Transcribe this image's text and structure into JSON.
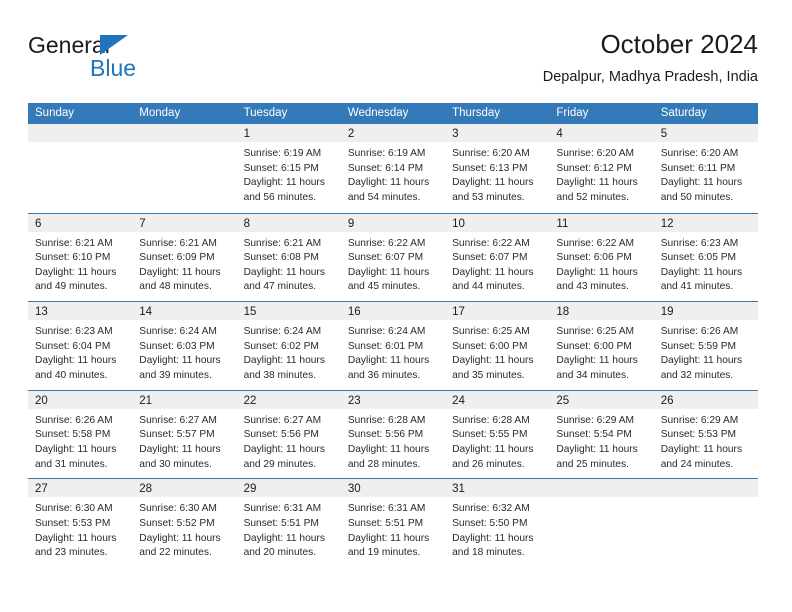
{
  "brand": {
    "name_primary": "General",
    "name_secondary": "Blue",
    "logo_icon": "blue-triangle-icon"
  },
  "header": {
    "title": "October 2024",
    "subtitle": "Depalpur, Madhya Pradesh, India"
  },
  "colors": {
    "header_blue": "#3479b8",
    "brand_blue": "#1f74bb",
    "day_band_gray": "#efefef",
    "text": "#1b1b1b"
  },
  "weekdays": [
    "Sunday",
    "Monday",
    "Tuesday",
    "Wednesday",
    "Thursday",
    "Friday",
    "Saturday"
  ],
  "weeks": [
    [
      {
        "day": "",
        "empty": true
      },
      {
        "day": "",
        "empty": true
      },
      {
        "day": "1",
        "sunrise": "Sunrise: 6:19 AM",
        "sunset": "Sunset: 6:15 PM",
        "daylight_1": "Daylight: 11 hours",
        "daylight_2": "and 56 minutes."
      },
      {
        "day": "2",
        "sunrise": "Sunrise: 6:19 AM",
        "sunset": "Sunset: 6:14 PM",
        "daylight_1": "Daylight: 11 hours",
        "daylight_2": "and 54 minutes."
      },
      {
        "day": "3",
        "sunrise": "Sunrise: 6:20 AM",
        "sunset": "Sunset: 6:13 PM",
        "daylight_1": "Daylight: 11 hours",
        "daylight_2": "and 53 minutes."
      },
      {
        "day": "4",
        "sunrise": "Sunrise: 6:20 AM",
        "sunset": "Sunset: 6:12 PM",
        "daylight_1": "Daylight: 11 hours",
        "daylight_2": "and 52 minutes."
      },
      {
        "day": "5",
        "sunrise": "Sunrise: 6:20 AM",
        "sunset": "Sunset: 6:11 PM",
        "daylight_1": "Daylight: 11 hours",
        "daylight_2": "and 50 minutes."
      }
    ],
    [
      {
        "day": "6",
        "sunrise": "Sunrise: 6:21 AM",
        "sunset": "Sunset: 6:10 PM",
        "daylight_1": "Daylight: 11 hours",
        "daylight_2": "and 49 minutes."
      },
      {
        "day": "7",
        "sunrise": "Sunrise: 6:21 AM",
        "sunset": "Sunset: 6:09 PM",
        "daylight_1": "Daylight: 11 hours",
        "daylight_2": "and 48 minutes."
      },
      {
        "day": "8",
        "sunrise": "Sunrise: 6:21 AM",
        "sunset": "Sunset: 6:08 PM",
        "daylight_1": "Daylight: 11 hours",
        "daylight_2": "and 47 minutes."
      },
      {
        "day": "9",
        "sunrise": "Sunrise: 6:22 AM",
        "sunset": "Sunset: 6:07 PM",
        "daylight_1": "Daylight: 11 hours",
        "daylight_2": "and 45 minutes."
      },
      {
        "day": "10",
        "sunrise": "Sunrise: 6:22 AM",
        "sunset": "Sunset: 6:07 PM",
        "daylight_1": "Daylight: 11 hours",
        "daylight_2": "and 44 minutes."
      },
      {
        "day": "11",
        "sunrise": "Sunrise: 6:22 AM",
        "sunset": "Sunset: 6:06 PM",
        "daylight_1": "Daylight: 11 hours",
        "daylight_2": "and 43 minutes."
      },
      {
        "day": "12",
        "sunrise": "Sunrise: 6:23 AM",
        "sunset": "Sunset: 6:05 PM",
        "daylight_1": "Daylight: 11 hours",
        "daylight_2": "and 41 minutes."
      }
    ],
    [
      {
        "day": "13",
        "sunrise": "Sunrise: 6:23 AM",
        "sunset": "Sunset: 6:04 PM",
        "daylight_1": "Daylight: 11 hours",
        "daylight_2": "and 40 minutes."
      },
      {
        "day": "14",
        "sunrise": "Sunrise: 6:24 AM",
        "sunset": "Sunset: 6:03 PM",
        "daylight_1": "Daylight: 11 hours",
        "daylight_2": "and 39 minutes."
      },
      {
        "day": "15",
        "sunrise": "Sunrise: 6:24 AM",
        "sunset": "Sunset: 6:02 PM",
        "daylight_1": "Daylight: 11 hours",
        "daylight_2": "and 38 minutes."
      },
      {
        "day": "16",
        "sunrise": "Sunrise: 6:24 AM",
        "sunset": "Sunset: 6:01 PM",
        "daylight_1": "Daylight: 11 hours",
        "daylight_2": "and 36 minutes."
      },
      {
        "day": "17",
        "sunrise": "Sunrise: 6:25 AM",
        "sunset": "Sunset: 6:00 PM",
        "daylight_1": "Daylight: 11 hours",
        "daylight_2": "and 35 minutes."
      },
      {
        "day": "18",
        "sunrise": "Sunrise: 6:25 AM",
        "sunset": "Sunset: 6:00 PM",
        "daylight_1": "Daylight: 11 hours",
        "daylight_2": "and 34 minutes."
      },
      {
        "day": "19",
        "sunrise": "Sunrise: 6:26 AM",
        "sunset": "Sunset: 5:59 PM",
        "daylight_1": "Daylight: 11 hours",
        "daylight_2": "and 32 minutes."
      }
    ],
    [
      {
        "day": "20",
        "sunrise": "Sunrise: 6:26 AM",
        "sunset": "Sunset: 5:58 PM",
        "daylight_1": "Daylight: 11 hours",
        "daylight_2": "and 31 minutes."
      },
      {
        "day": "21",
        "sunrise": "Sunrise: 6:27 AM",
        "sunset": "Sunset: 5:57 PM",
        "daylight_1": "Daylight: 11 hours",
        "daylight_2": "and 30 minutes."
      },
      {
        "day": "22",
        "sunrise": "Sunrise: 6:27 AM",
        "sunset": "Sunset: 5:56 PM",
        "daylight_1": "Daylight: 11 hours",
        "daylight_2": "and 29 minutes."
      },
      {
        "day": "23",
        "sunrise": "Sunrise: 6:28 AM",
        "sunset": "Sunset: 5:56 PM",
        "daylight_1": "Daylight: 11 hours",
        "daylight_2": "and 28 minutes."
      },
      {
        "day": "24",
        "sunrise": "Sunrise: 6:28 AM",
        "sunset": "Sunset: 5:55 PM",
        "daylight_1": "Daylight: 11 hours",
        "daylight_2": "and 26 minutes."
      },
      {
        "day": "25",
        "sunrise": "Sunrise: 6:29 AM",
        "sunset": "Sunset: 5:54 PM",
        "daylight_1": "Daylight: 11 hours",
        "daylight_2": "and 25 minutes."
      },
      {
        "day": "26",
        "sunrise": "Sunrise: 6:29 AM",
        "sunset": "Sunset: 5:53 PM",
        "daylight_1": "Daylight: 11 hours",
        "daylight_2": "and 24 minutes."
      }
    ],
    [
      {
        "day": "27",
        "sunrise": "Sunrise: 6:30 AM",
        "sunset": "Sunset: 5:53 PM",
        "daylight_1": "Daylight: 11 hours",
        "daylight_2": "and 23 minutes."
      },
      {
        "day": "28",
        "sunrise": "Sunrise: 6:30 AM",
        "sunset": "Sunset: 5:52 PM",
        "daylight_1": "Daylight: 11 hours",
        "daylight_2": "and 22 minutes."
      },
      {
        "day": "29",
        "sunrise": "Sunrise: 6:31 AM",
        "sunset": "Sunset: 5:51 PM",
        "daylight_1": "Daylight: 11 hours",
        "daylight_2": "and 20 minutes."
      },
      {
        "day": "30",
        "sunrise": "Sunrise: 6:31 AM",
        "sunset": "Sunset: 5:51 PM",
        "daylight_1": "Daylight: 11 hours",
        "daylight_2": "and 19 minutes."
      },
      {
        "day": "31",
        "sunrise": "Sunrise: 6:32 AM",
        "sunset": "Sunset: 5:50 PM",
        "daylight_1": "Daylight: 11 hours",
        "daylight_2": "and 18 minutes."
      },
      {
        "day": "",
        "empty": true
      },
      {
        "day": "",
        "empty": true
      }
    ]
  ]
}
